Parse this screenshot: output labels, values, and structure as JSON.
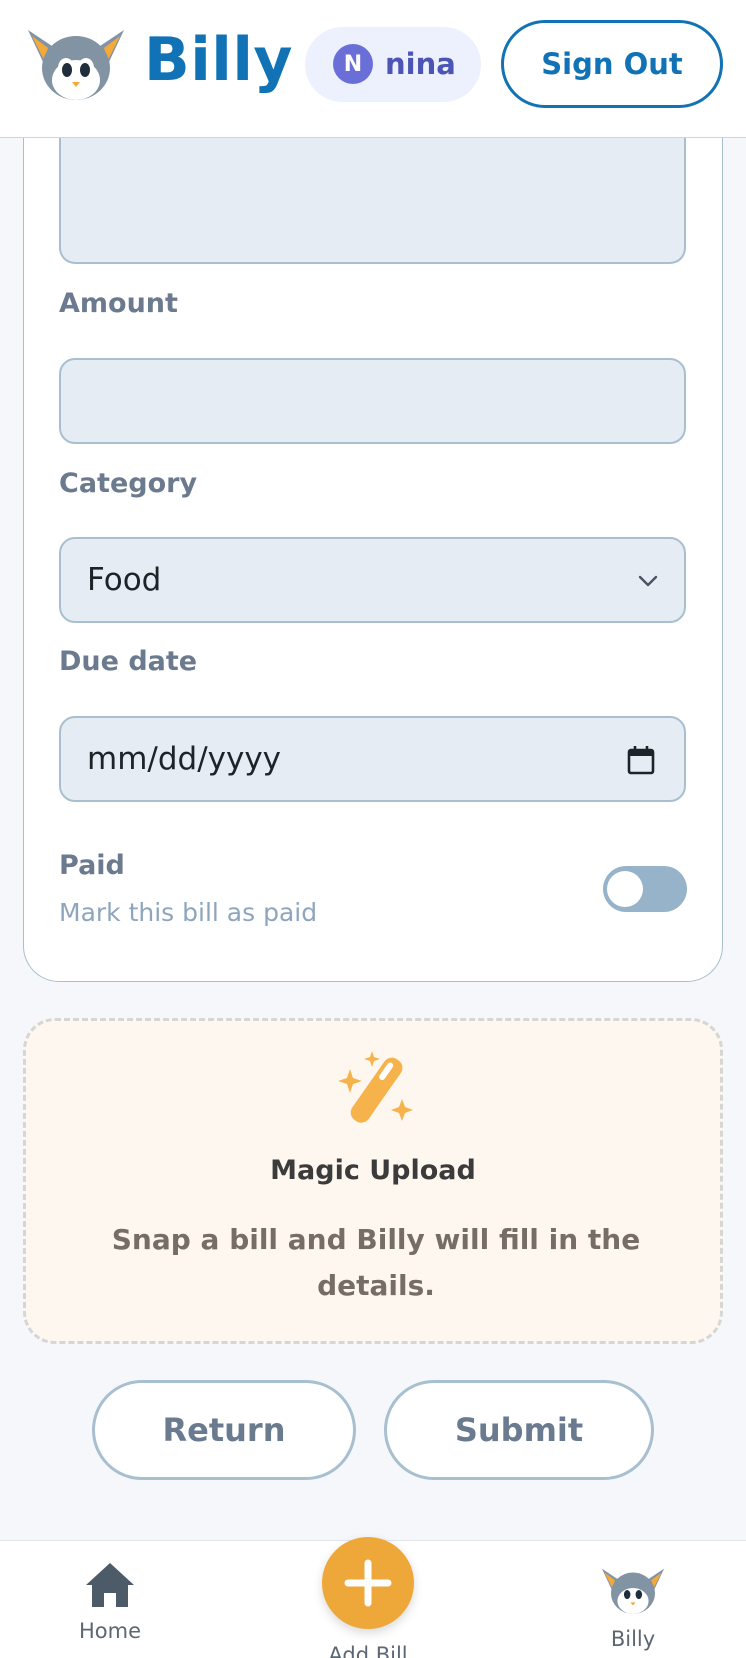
{
  "header": {
    "brand": "Billy",
    "user": {
      "initial": "N",
      "name": "nina"
    },
    "sign_out_label": "Sign Out"
  },
  "form": {
    "amount_label": "Amount",
    "amount_value": "",
    "category_label": "Category",
    "category_value": "Food",
    "due_date_label": "Due date",
    "due_date_placeholder": "mm/dd/yyyy",
    "paid_label": "Paid",
    "paid_sub": "Mark this bill as paid",
    "paid_on": false
  },
  "magic_upload": {
    "title": "Magic Upload",
    "description": "Snap a bill and Billy will fill in the details."
  },
  "actions": {
    "return_label": "Return",
    "submit_label": "Submit"
  },
  "bottom_nav": {
    "home_label": "Home",
    "add_label": "Add Bill",
    "billy_label": "Billy"
  },
  "colors": {
    "brand": "#1173b6",
    "accent": "#eea739",
    "field_bg": "#e6ecf3"
  }
}
